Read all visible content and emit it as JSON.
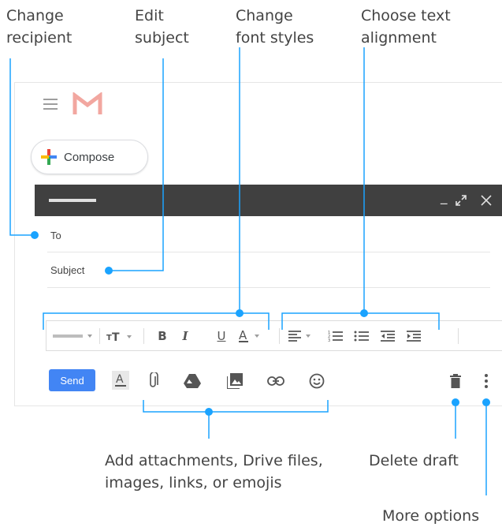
{
  "callouts": {
    "recipient": [
      "Change",
      "recipient"
    ],
    "subject": [
      "Edit",
      "subject"
    ],
    "font": [
      "Change",
      "font styles"
    ],
    "align": [
      "Choose text",
      "alignment"
    ],
    "attach": [
      "Add attachments, Drive files,",
      "images, links, or emojis"
    ],
    "delete": "Delete draft",
    "more": "More options"
  },
  "compose": {
    "label": "Compose"
  },
  "fields": {
    "to": "To",
    "subject": "Subject"
  },
  "send_label": "Send",
  "colors": {
    "accent": "#1aa3ff",
    "send": "#4285f4",
    "titlebar": "#404040"
  },
  "icons": [
    "hamburger-icon",
    "gmail-logo-icon",
    "compose-plus-icon",
    "minimize-icon",
    "expand-icon",
    "close-icon",
    "font-face-icon",
    "text-size-icon",
    "bold-icon",
    "italic-icon",
    "underline-icon",
    "text-color-icon",
    "align-icon",
    "numbered-list-icon",
    "bulleted-list-icon",
    "indent-less-icon",
    "indent-more-icon",
    "formatting-options-icon",
    "attach-file-icon",
    "drive-icon",
    "insert-photo-icon",
    "insert-link-icon",
    "emoji-icon",
    "delete-icon",
    "more-options-icon"
  ]
}
